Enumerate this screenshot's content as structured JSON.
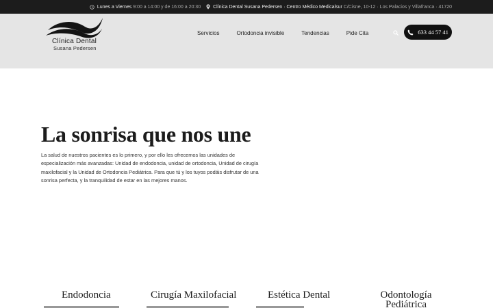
{
  "topbar": {
    "hours_label": "Lunes a Viernes",
    "hours_value": "9:00 a 14:00 y de 16:00 a 20:30",
    "clinic_label": "Clínica Dental Susana Pedersen · Centro Médico Medicalsur",
    "address": "C/Cisne, 10-12 · Los Palacios y Villafranca · 41720"
  },
  "logo": {
    "name": "Clínica Dental",
    "subtitle": "Susana Pedersen"
  },
  "nav": {
    "items": [
      "Servicios",
      "Ortodoncia invisible",
      "Tendencias",
      "Pide Cita"
    ]
  },
  "call": {
    "phone": "633 44 57 41"
  },
  "hero": {
    "title": "La sonrisa que nos une",
    "text": "La salud de nuestros pacientes es lo primero, y por ello les ofrecemos las unidades de especialización más avanzadas: Unidad de endodoncia, unidad de ortodoncia, Unidad de cirugía maxilofacial y la Unidad de Ortodoncia Pediátrica. Para que tú y los tuyos podáis disfrutar de una sonrisa perfecta, y la tranquilidad de estar en las mejores manos."
  },
  "services": [
    "Endodoncia",
    "Cirugía Maxilofacial",
    "Estética Dental",
    "Odontología Pediátrica"
  ],
  "colors": {
    "topbar_bg": "#1c1c1c",
    "header_bg": "#e5e5e5",
    "call_button_bg": "#111111",
    "text_dark": "#1c1c1c"
  },
  "icons": [
    "clock-icon",
    "location-pin-icon",
    "search-icon",
    "phone-icon"
  ]
}
